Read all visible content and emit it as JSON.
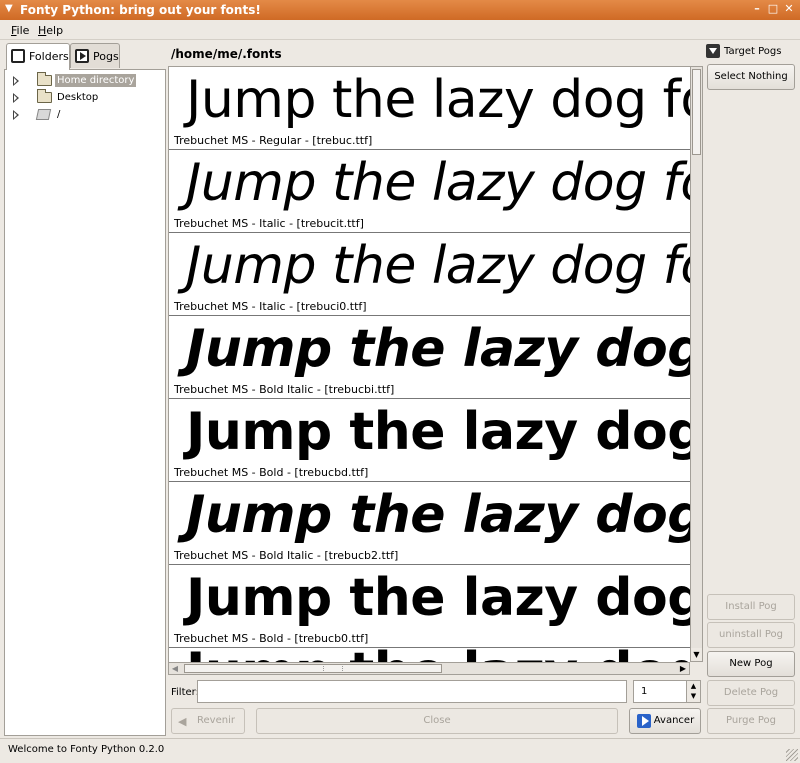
{
  "window": {
    "title": "Fonty Python: bring out your fonts!"
  },
  "menu": [
    {
      "label": "File",
      "mnemonic": "F",
      "rest": "ile"
    },
    {
      "label": "Help",
      "mnemonic": "H",
      "rest": "elp"
    }
  ],
  "tabs": [
    {
      "label": "Folders",
      "active": true
    },
    {
      "label": "Pogs",
      "active": false
    }
  ],
  "tree": [
    {
      "label": "Home directory",
      "icon": "folder-icon",
      "selected": true
    },
    {
      "label": "Desktop",
      "icon": "folder-icon",
      "selected": false
    },
    {
      "label": "/",
      "icon": "drive-icon",
      "selected": false
    }
  ],
  "path": "/home/me/.fonts",
  "sample_text": "Jump the lazy dog fonts",
  "fonts": [
    {
      "caption": "Trebuchet MS - Regular - [trebuc.ttf]",
      "style": "regular"
    },
    {
      "caption": "Trebuchet MS - Italic - [trebucit.ttf]",
      "style": "italic"
    },
    {
      "caption": "Trebuchet MS - Italic - [trebuci0.ttf]",
      "style": "italic"
    },
    {
      "caption": "Trebuchet MS - Bold Italic - [trebucbi.ttf]",
      "style": "bold italic"
    },
    {
      "caption": "Trebuchet MS - Bold - [trebucbd.ttf]",
      "style": "bold"
    },
    {
      "caption": "Trebuchet MS - Bold Italic - [trebucb2.ttf]",
      "style": "bold italic"
    },
    {
      "caption": "Trebuchet MS - Bold - [trebucb0.ttf]",
      "style": "bold"
    }
  ],
  "filter": {
    "label": "Filter:",
    "value": "",
    "page": "1"
  },
  "nav": {
    "back": "Revenir",
    "close": "Close",
    "forward": "Avancer"
  },
  "target": {
    "header": "Target Pogs",
    "select_nothing": "Select Nothing"
  },
  "pog_buttons": {
    "install": "Install Pog",
    "uninstall": "uninstall Pog",
    "new": "New Pog",
    "delete": "Delete Pog",
    "purge": "Purge Pog"
  },
  "status": "Welcome to Fonty Python 0.2.0",
  "colors": {
    "titlebar": "#d97a35",
    "selection": "#a9a49c",
    "accent": "#2a63c9"
  }
}
